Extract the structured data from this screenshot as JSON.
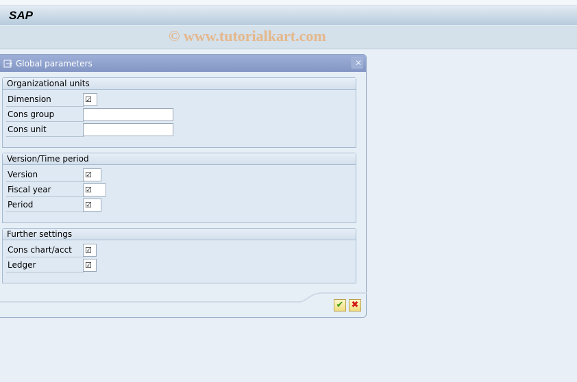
{
  "app": {
    "title": "SAP",
    "watermark": "© www.tutorialkart.com"
  },
  "dialog": {
    "title": "Global parameters",
    "icon": "dialog-icon",
    "groups": [
      {
        "title": "Organizational units",
        "fields": [
          {
            "label": "Dimension",
            "type": "checkbox",
            "checked": true
          },
          {
            "label": "Cons group",
            "type": "text",
            "value": ""
          },
          {
            "label": "Cons unit",
            "type": "text",
            "value": ""
          }
        ]
      },
      {
        "title": "Version/Time period",
        "fields": [
          {
            "label": "Version",
            "type": "checkbox",
            "checked": true
          },
          {
            "label": "Fiscal year",
            "type": "checkbox",
            "checked": true
          },
          {
            "label": "Period",
            "type": "checkbox",
            "checked": true
          }
        ]
      },
      {
        "title": "Further settings",
        "fields": [
          {
            "label": "Cons chart/acct",
            "type": "checkbox",
            "checked": true
          },
          {
            "label": "Ledger",
            "type": "checkbox",
            "checked": true
          }
        ]
      }
    ],
    "buttons": {
      "confirm": "✔",
      "cancel": "✖"
    },
    "colors": {
      "confirm": "#3a9a10",
      "cancel": "#d01010"
    }
  }
}
